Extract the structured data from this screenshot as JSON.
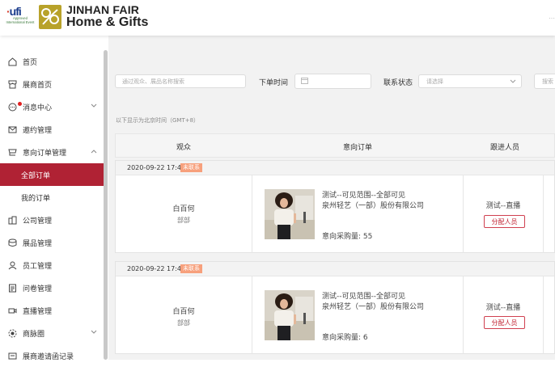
{
  "header": {
    "ufi_logo": "ufi",
    "ufi_subtext": "Approved International Event",
    "brand_line1": "JINHAN FAIR",
    "brand_line2": "Home & Gifts",
    "right_text": "…"
  },
  "sidebar": {
    "items": [
      {
        "label": "首页",
        "icon": "home-icon"
      },
      {
        "label": "展商首页",
        "icon": "shop-icon"
      },
      {
        "label": "消息中心",
        "icon": "message-icon",
        "has_dot": true,
        "expandable": true
      },
      {
        "label": "邀约管理",
        "icon": "mail-icon"
      },
      {
        "label": "意向订单管理",
        "icon": "cart-icon",
        "expandable": true,
        "expanded": true
      },
      {
        "label": "全部订单",
        "sub": true,
        "active": true
      },
      {
        "label": "我的订单",
        "sub": true
      },
      {
        "label": "公司管理",
        "icon": "building-icon"
      },
      {
        "label": "展品管理",
        "icon": "box-icon"
      },
      {
        "label": "员工管理",
        "icon": "user-icon"
      },
      {
        "label": "问卷管理",
        "icon": "survey-icon"
      },
      {
        "label": "直播管理",
        "icon": "video-icon"
      },
      {
        "label": "商脉圈",
        "icon": "network-icon",
        "expandable": true
      },
      {
        "label": "展商邀请函记录",
        "icon": "invite-icon"
      }
    ]
  },
  "filters": {
    "search_placeholder": "通过观众、展品名称搜索",
    "order_time_label": "下单时间",
    "contact_status_label": "联系状态",
    "contact_status_placeholder": "请选择",
    "search_button": "搜索"
  },
  "timezone_note": "以下显示为北京时间（GMT+8）",
  "table": {
    "headers": [
      "观众",
      "意向订单",
      "跟进人员"
    ]
  },
  "orders": [
    {
      "datetime": "2020-09-22 17:43",
      "status": "未联系",
      "audience_name": "白百何",
      "audience_sub": "部部",
      "product_title": "测试--可见范围--全部可见",
      "company": "泉州轻艺（一部）股份有限公司",
      "quantity_label": "意向采购量:",
      "quantity": "55",
      "follower": "测试--直播",
      "assign_label": "分配人员"
    },
    {
      "datetime": "2020-09-22 17:43",
      "status": "未联系",
      "audience_name": "白百何",
      "audience_sub": "部部",
      "product_title": "测试--可见范围--全部可见",
      "company": "泉州轻艺（一部）股份有限公司",
      "quantity_label": "意向采购量:",
      "quantity": "6",
      "follower": "测试--直播",
      "assign_label": "分配人员"
    }
  ],
  "colors": {
    "accent": "#b02234",
    "badge": "#f7a07c",
    "brand_gold": "#b8a22a"
  }
}
